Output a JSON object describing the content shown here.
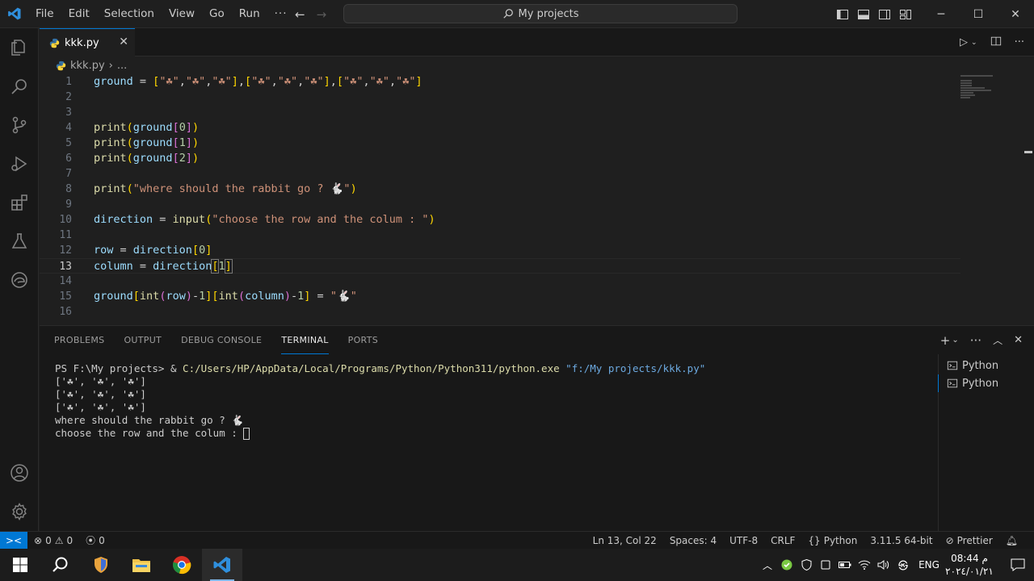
{
  "menu": [
    "File",
    "Edit",
    "Selection",
    "View",
    "Go",
    "Run",
    "···"
  ],
  "search": {
    "label": "My projects"
  },
  "tab": {
    "name": "kkk.py",
    "close": "✕"
  },
  "breadcrumb": {
    "file": "kkk.py",
    "more": "..."
  },
  "code_lines": [
    {
      "n": "1",
      "t": "ground = [\"☘\",\"☘\",\"☘\"],[\"☘\",\"☘\",\"☘\"],[\"☘\",\"☘\",\"☘\"]"
    },
    {
      "n": "2",
      "t": ""
    },
    {
      "n": "3",
      "t": ""
    },
    {
      "n": "4",
      "t": "print(ground[0])"
    },
    {
      "n": "5",
      "t": "print(ground[1])"
    },
    {
      "n": "6",
      "t": "print(ground[2])"
    },
    {
      "n": "7",
      "t": ""
    },
    {
      "n": "8",
      "t": "print(\"where should the rabbit go ? 🐇\")"
    },
    {
      "n": "9",
      "t": ""
    },
    {
      "n": "10",
      "t": "direction = input(\"choose the row and the colum : \")"
    },
    {
      "n": "11",
      "t": ""
    },
    {
      "n": "12",
      "t": "row = direction[0]"
    },
    {
      "n": "13",
      "t": "column = direction[1]"
    },
    {
      "n": "14",
      "t": ""
    },
    {
      "n": "15",
      "t": "ground[int(row)-1][int(column)-1] = \"🐇\""
    },
    {
      "n": "16",
      "t": ""
    }
  ],
  "panel": {
    "tabs": [
      "PROBLEMS",
      "OUTPUT",
      "DEBUG CONSOLE",
      "TERMINAL",
      "PORTS"
    ],
    "active_tab": "TERMINAL"
  },
  "terminal": {
    "prompt": "PS F:\\My projects> & ",
    "command": "C:/Users/HP/AppData/Local/Programs/Python/Python311/python.exe",
    "arg": "\"f:/My projects/kkk.py\"",
    "output": [
      "['☘', '☘', '☘']",
      "['☘', '☘', '☘']",
      "['☘', '☘', '☘']",
      "where should the rabbit go ? 🐇"
    ],
    "input_prompt": "choose the row and the colum : "
  },
  "terminal_list": [
    "Python",
    "Python"
  ],
  "status": {
    "remote": "><",
    "errors": "0",
    "warnings": "0",
    "ports": "0",
    "position": "Ln 13, Col 22",
    "spaces": "Spaces: 4",
    "encoding": "UTF-8",
    "eol": "CRLF",
    "language": "Python",
    "interpreter": "3.11.5 64-bit",
    "formatter": "Prettier"
  },
  "taskbar": {
    "lang": "ENG",
    "time": "08:44 م",
    "date": "٢٠٢٤/٠١/٢١"
  },
  "colors": {
    "accent": "#0078d4",
    "function": "#dcdcaa",
    "variable": "#9cdcfe",
    "string": "#ce9178",
    "number": "#b5cea8"
  }
}
